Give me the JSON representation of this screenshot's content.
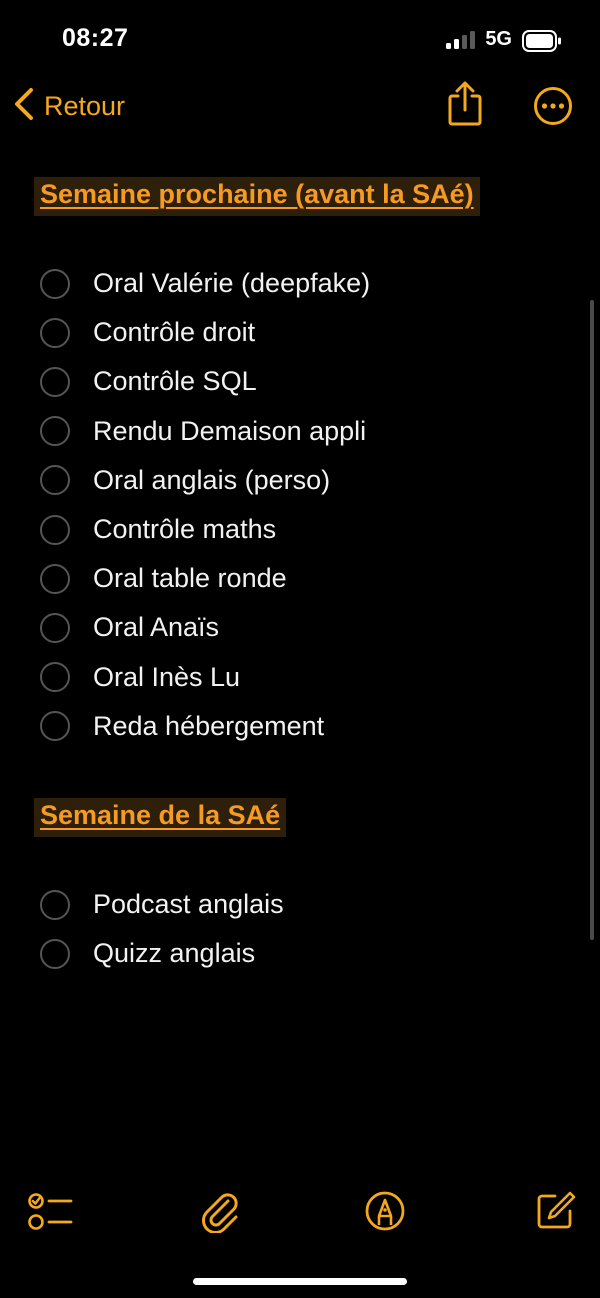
{
  "status_bar": {
    "time": "08:27",
    "network": "5G"
  },
  "nav": {
    "back_label": "Retour",
    "back_icon": "chevron-left-icon",
    "share_icon": "share-icon",
    "more_icon": "ellipsis-circle-icon"
  },
  "note": {
    "sections": [
      {
        "heading": "Semaine prochaine (avant la SAé)",
        "items": [
          "Oral Valérie (deepfake)",
          "Contrôle droit",
          "Contrôle SQL",
          "Rendu Demaison appli",
          "Oral anglais (perso)",
          "Contrôle maths",
          "Oral table ronde",
          "Oral Anaïs",
          "Oral Inès Lu",
          "Reda hébergement"
        ]
      },
      {
        "heading": "Semaine de la SAé",
        "items": [
          "Podcast anglais",
          "Quizz anglais"
        ]
      }
    ]
  },
  "toolbar": {
    "checklist_icon": "checklist-icon",
    "attachment_icon": "paperclip-icon",
    "markup_icon": "markup-pen-icon",
    "compose_icon": "compose-icon"
  },
  "colors": {
    "accent": "#f4a81d",
    "heading": "#f59b23",
    "background": "#000000",
    "text": "#f2f2f2",
    "checkbox_border": "#555555"
  }
}
